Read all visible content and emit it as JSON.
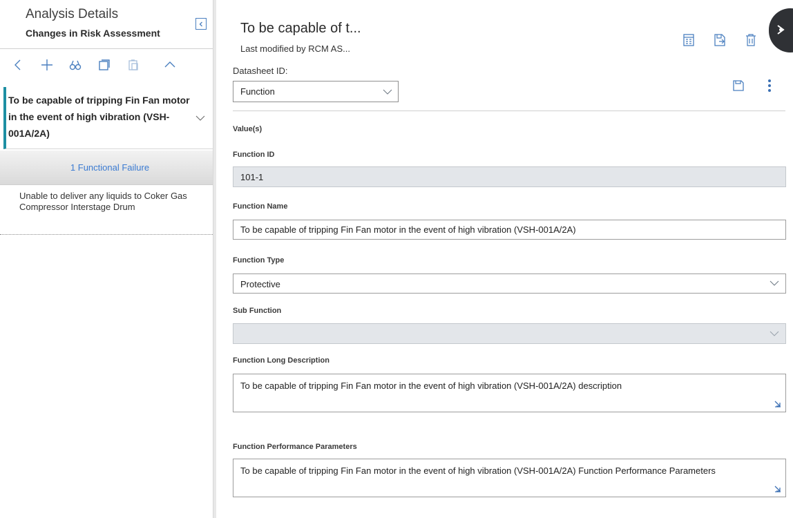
{
  "left_panel": {
    "title": "Analysis Details",
    "subtitle": "Changes in Risk Assessment",
    "toolbar_icons": [
      "back-icon",
      "add-icon",
      "search-binoculars-icon",
      "copy-icon",
      "paste-icon",
      "collapse-up-icon"
    ],
    "selected_item": "To be capable of tripping Fin Fan motor in the event of high vibration (VSH-001A/2A)",
    "functional_failure_count": "1 Functional Failure",
    "functional_failure_item": "Unable to deliver any liquids to Coker Gas Compressor Interstage Drum"
  },
  "header": {
    "title": "To be capable of t...",
    "subtitle": "Last modified by RCM AS..."
  },
  "datasheet": {
    "label": "Datasheet ID:",
    "selected": "Function"
  },
  "form": {
    "section": "Value(s)",
    "function_id_label": "Function ID",
    "function_id_value": "101-1",
    "function_name_label": "Function Name",
    "function_name_value": "To be capable of tripping Fin Fan motor in the event of high vibration (VSH-001A/2A)",
    "function_type_label": "Function Type",
    "function_type_value": "Protective",
    "sub_function_label": "Sub Function",
    "sub_function_value": "",
    "long_description_label": "Function Long Description",
    "long_description_value": "To be capable of tripping Fin Fan motor in the event of high vibration (VSH-001A/2A) description",
    "performance_label": "Function Performance Parameters",
    "performance_value": "To be capable of tripping Fin Fan motor in the event of high vibration (VSH-001A/2A) Function Performance Parameters"
  },
  "colors": {
    "accent_teal": "#1d8fa3",
    "link_blue": "#3b7bd2",
    "icon_blue": "#4a7fbf"
  }
}
